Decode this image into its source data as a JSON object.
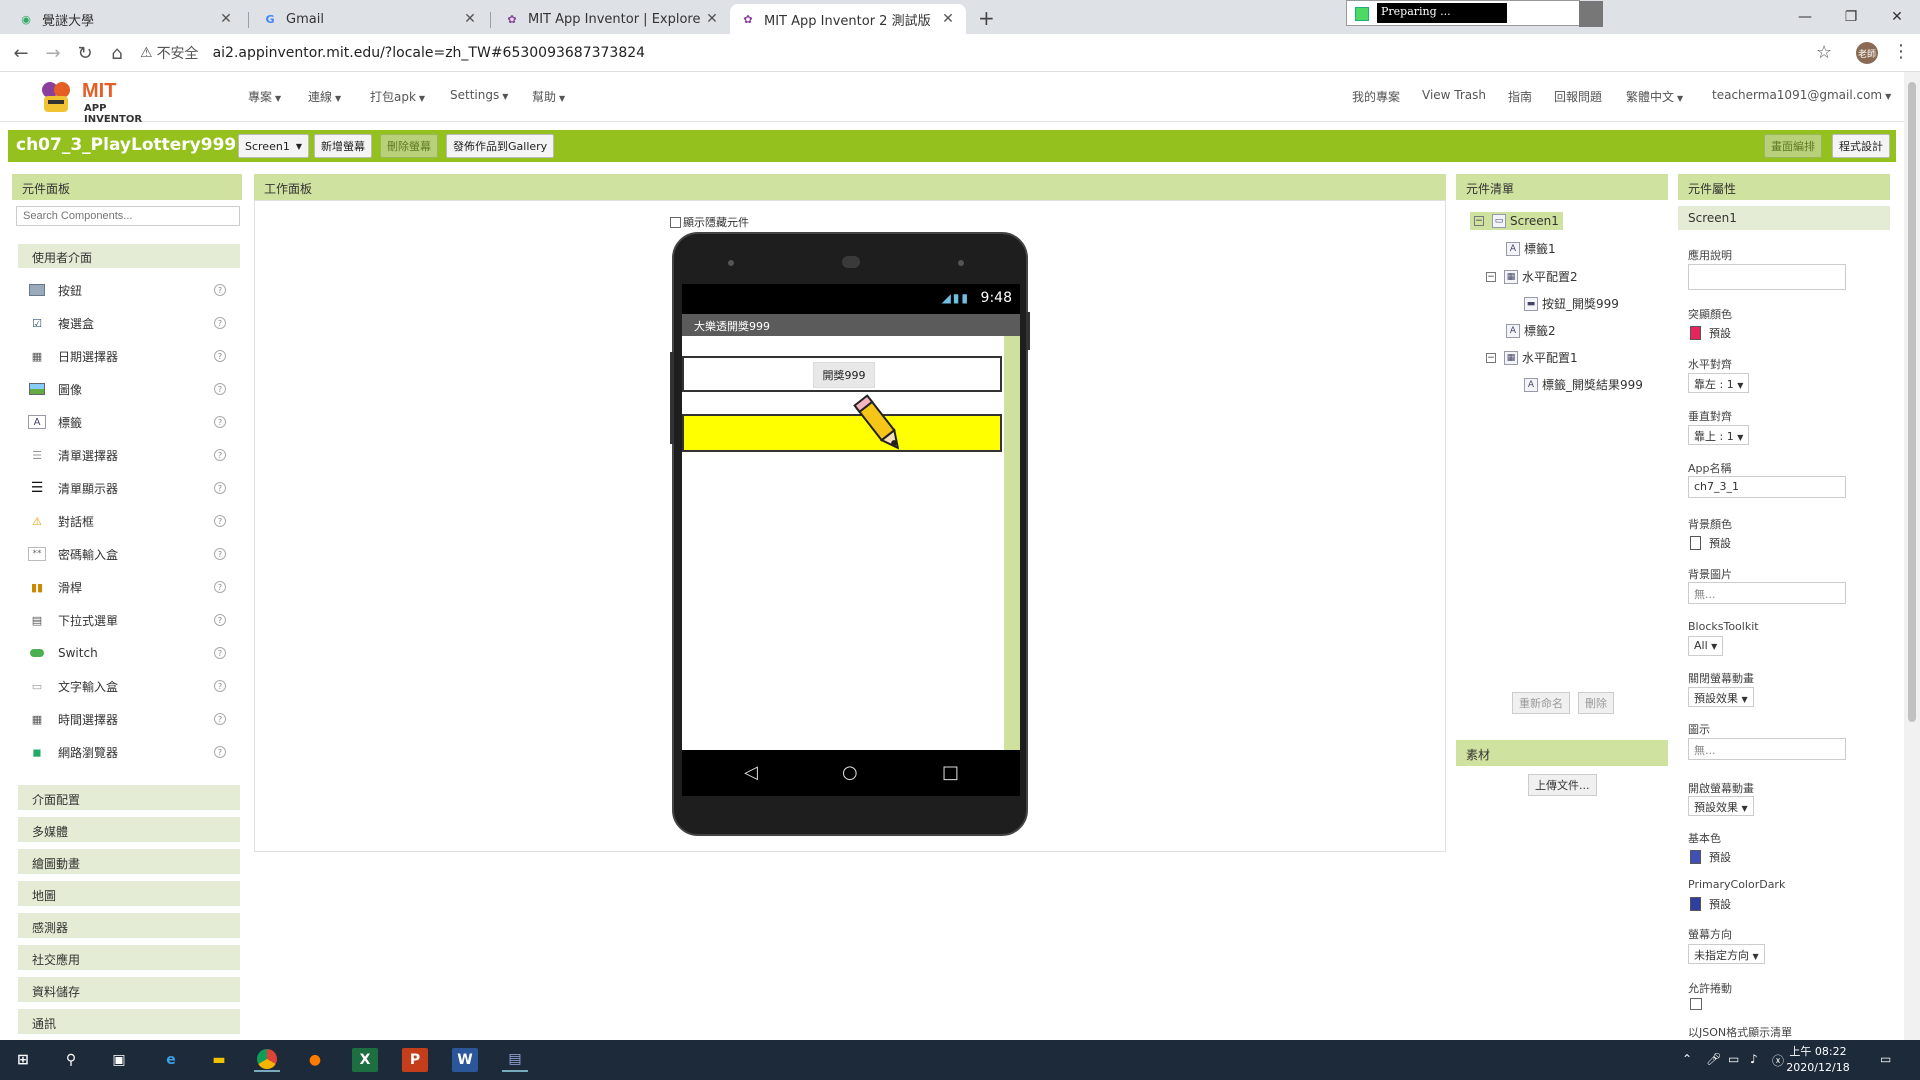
{
  "browser": {
    "tabs": [
      {
        "title": "覺謎大學",
        "icon": "site-globe-icon"
      },
      {
        "title": "Gmail",
        "icon": "google-g-icon"
      },
      {
        "title": "MIT App Inventor | Explore MIT",
        "icon": "app-inventor-icon"
      },
      {
        "title": "MIT App Inventor 2 測試版",
        "icon": "app-inventor-icon"
      }
    ],
    "insecure_label": "不安全",
    "url": "ai2.appinventor.mit.edu/?locale=zh_TW#6530093687373824",
    "preparing_text": "Preparing ...",
    "profile_initials": "老師"
  },
  "header": {
    "logo_main": "MIT",
    "logo_sub": "APP INVENTOR",
    "menus": [
      "專案",
      "連線",
      "打包apk",
      "Settings",
      "幫助"
    ],
    "right_links": [
      "我的專案",
      "View Trash",
      "指南",
      "回報問題",
      "繁體中文",
      "teacherma1091@gmail.com"
    ]
  },
  "toolbar": {
    "project_name": "ch07_3_PlayLottery999",
    "screen_select": "Screen1",
    "add_screen": "新增螢幕",
    "remove_screen": "刪除螢幕",
    "publish": "發佈作品到Gallery",
    "designer": "畫面編排",
    "blocks": "程式設計"
  },
  "palette": {
    "title": "元件面板",
    "search_placeholder": "Search Components...",
    "open_category": "使用者介面",
    "items": [
      {
        "label": "按鈕",
        "icon": "button-icon"
      },
      {
        "label": "複選盒",
        "icon": "checkbox-icon"
      },
      {
        "label": "日期選擇器",
        "icon": "datepicker-icon"
      },
      {
        "label": "圖像",
        "icon": "image-icon"
      },
      {
        "label": "標籤",
        "icon": "label-icon"
      },
      {
        "label": "清單選擇器",
        "icon": "listpicker-icon"
      },
      {
        "label": "清單顯示器",
        "icon": "listview-icon"
      },
      {
        "label": "對話框",
        "icon": "notifier-icon"
      },
      {
        "label": "密碼輸入盒",
        "icon": "password-icon"
      },
      {
        "label": "滑桿",
        "icon": "slider-icon"
      },
      {
        "label": "下拉式選單",
        "icon": "spinner-icon"
      },
      {
        "label": "Switch",
        "icon": "switch-icon"
      },
      {
        "label": "文字輸入盒",
        "icon": "textbox-icon"
      },
      {
        "label": "時間選擇器",
        "icon": "timepicker-icon"
      },
      {
        "label": "網路瀏覽器",
        "icon": "webviewer-icon"
      }
    ],
    "help_glyph": "?",
    "categories": [
      "介面配置",
      "多媒體",
      "繪圖動畫",
      "地圖",
      "感測器",
      "社交應用",
      "資料儲存",
      "通訊"
    ]
  },
  "viewer": {
    "title": "工作面板",
    "show_hidden": "顯示隱藏元件",
    "phone": {
      "time": "9:48",
      "app_title": "大樂透開獎999",
      "button_text": "開獎999"
    }
  },
  "components": {
    "title": "元件清單",
    "tree": [
      {
        "label": "Screen1",
        "icon": "screen-icon"
      },
      {
        "label": "標籤1",
        "icon": "label-icon"
      },
      {
        "label": "水平配置2",
        "icon": "horizontal-arrangement-icon"
      },
      {
        "label": "按鈕_開獎999",
        "icon": "button-icon"
      },
      {
        "label": "標籤2",
        "icon": "label-icon"
      },
      {
        "label": "水平配置1",
        "icon": "horizontal-arrangement-icon"
      },
      {
        "label": "標籤_開獎結果999",
        "icon": "label-icon"
      }
    ],
    "rename": "重新命名",
    "delete": "刪除",
    "media_title": "素材",
    "upload": "上傳文件..."
  },
  "properties": {
    "title": "元件屬性",
    "component": "Screen1",
    "about_label": "應用說明",
    "accent_label": "突顯顏色",
    "accent_value": "預設",
    "accent_color": "#e8245c",
    "halign_label": "水平對齊",
    "halign_value": "靠左 : 1",
    "valign_label": "垂直對齊",
    "valign_value": "靠上 : 1",
    "appname_label": "App名稱",
    "appname_value": "ch7_3_1",
    "bgcolor_label": "背景顏色",
    "bgcolor_value": "預設",
    "bgimage_label": "背景圖片",
    "bgimage_value": "無...",
    "blockstoolkit_label": "BlocksToolkit",
    "blockstoolkit_value": "All",
    "close_anim_label": "關閉螢幕動畫",
    "close_anim_value": "預設效果",
    "icon_label": "圖示",
    "icon_value": "無...",
    "open_anim_label": "開啟螢幕動畫",
    "open_anim_value": "預設效果",
    "primary_label": "基本色",
    "primary_value": "預設",
    "primary_color": "#3f51b5",
    "primarydark_label": "PrimaryColorDark",
    "primarydark_value": "預設",
    "primarydark_color": "#303f9f",
    "orientation_label": "螢幕方向",
    "orientation_value": "未指定方向",
    "scroll_label": "允許捲動",
    "json_label": "以JSON格式顯示清單"
  },
  "taskbar": {
    "time": "上午 08:22",
    "date": "2020/12/18"
  },
  "colors": {
    "green_bar": "#95c11f",
    "panel_head": "#d0e2a0",
    "yellow_label": "#ffff00"
  }
}
